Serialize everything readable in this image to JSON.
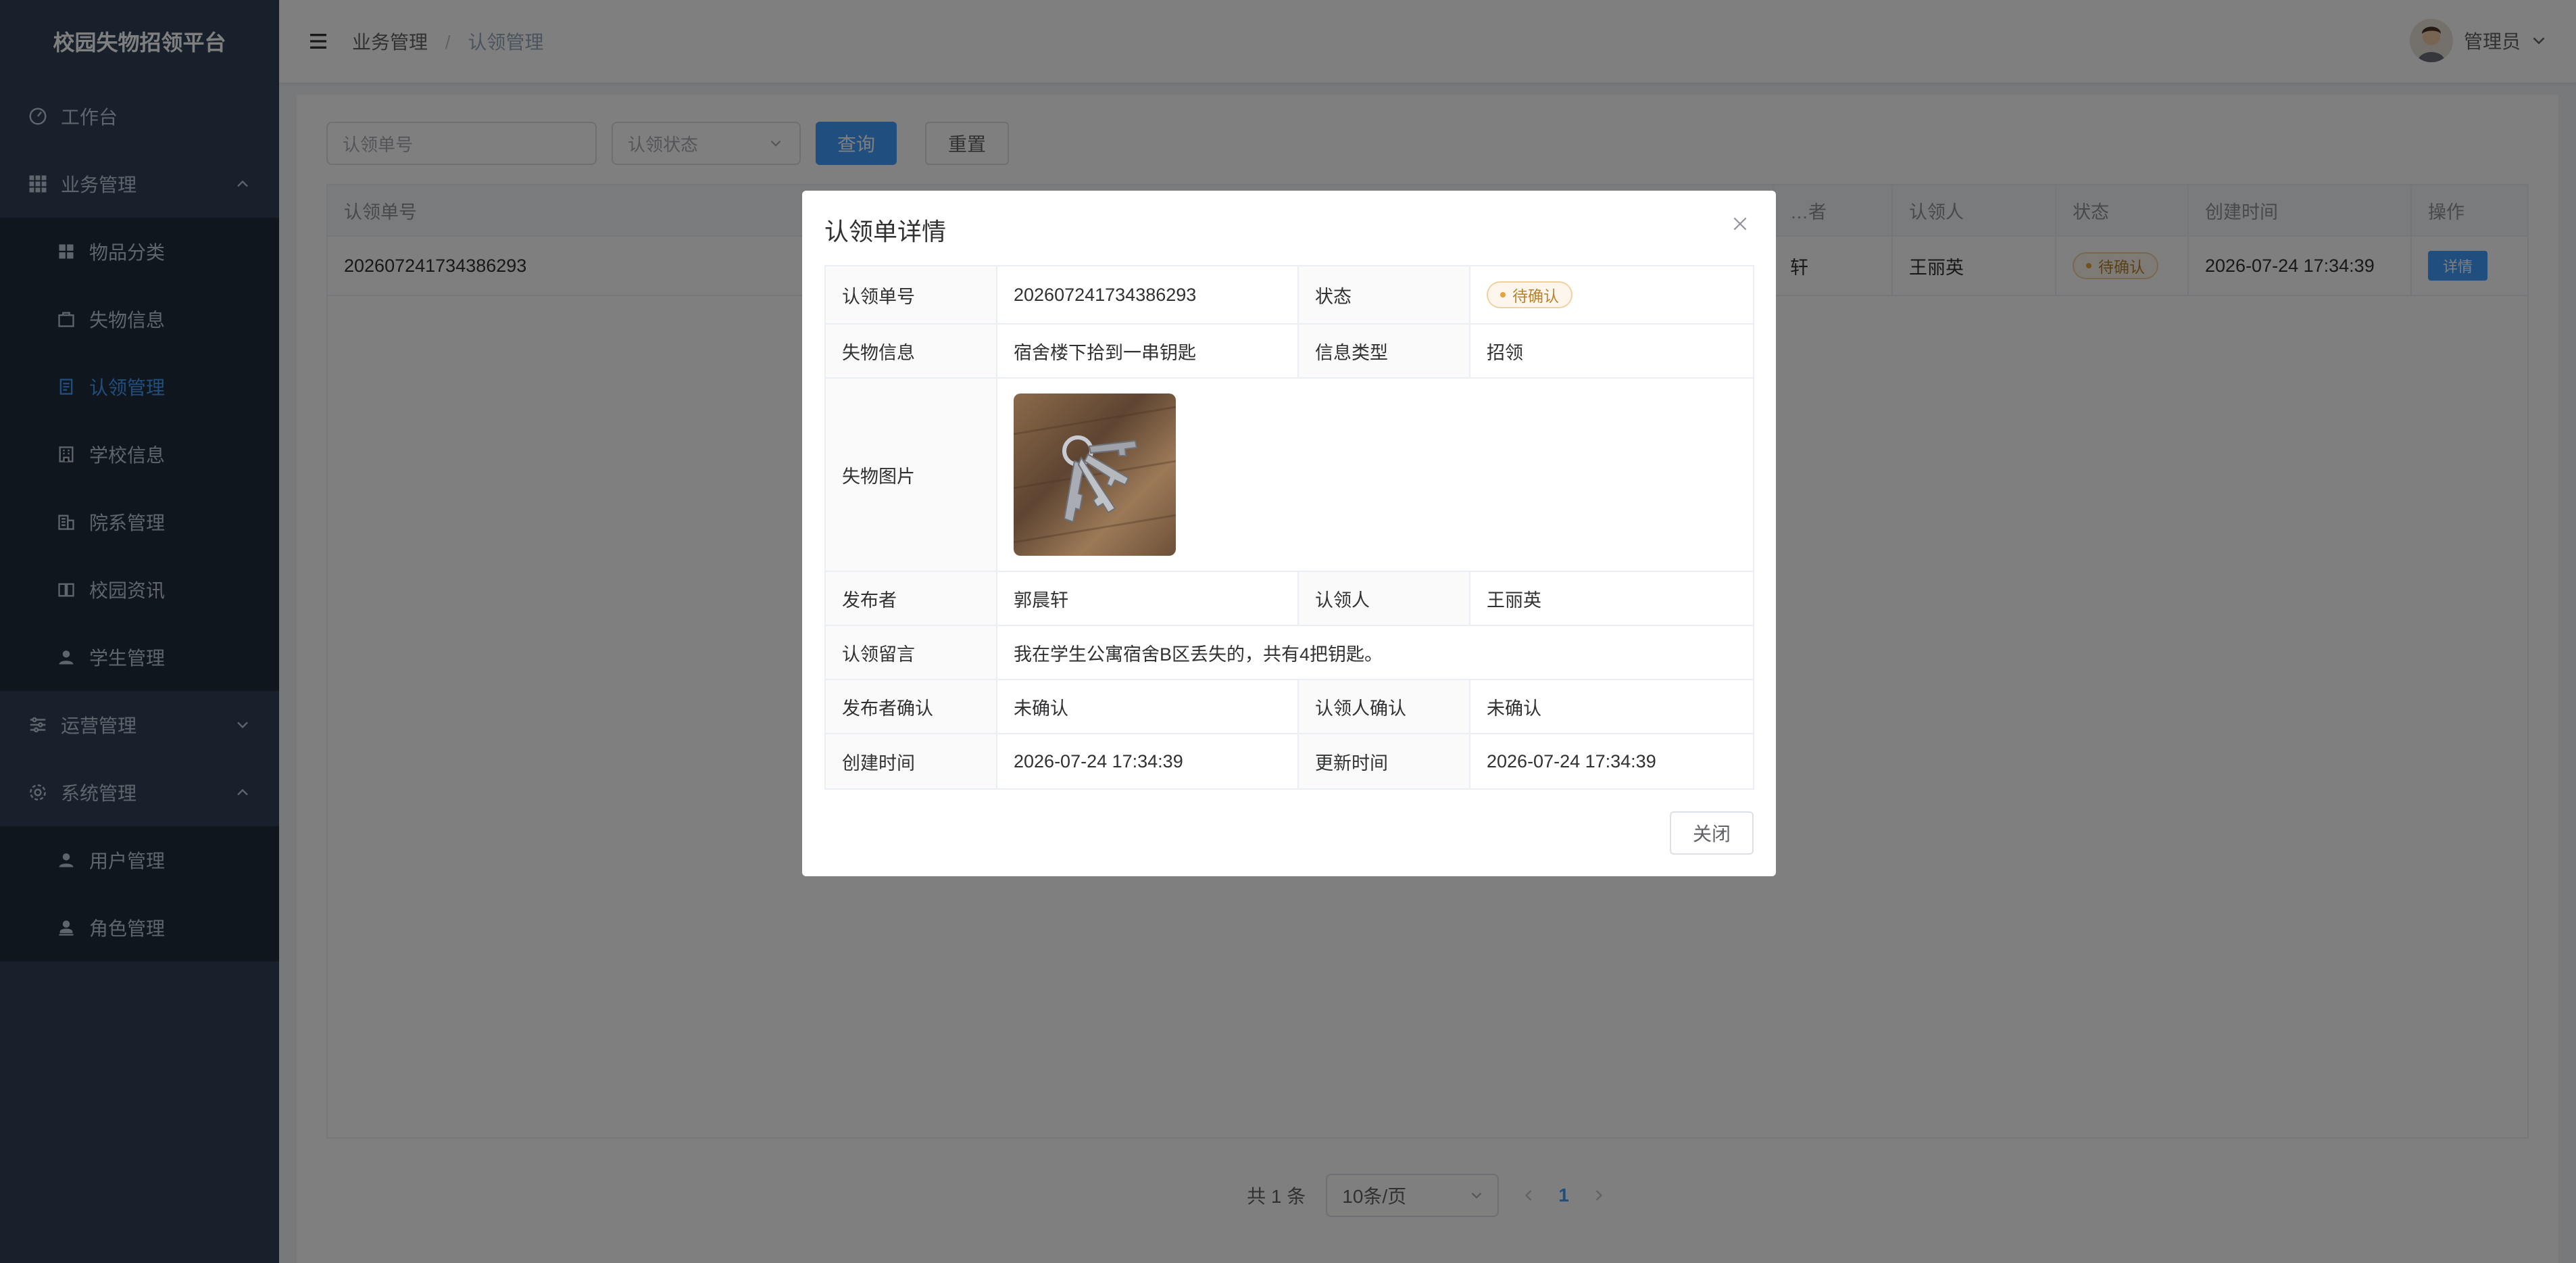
{
  "app": {
    "title": "校园失物招领平台"
  },
  "sidebar": {
    "items": [
      {
        "label": "工作台",
        "icon": "dashboard-icon"
      },
      {
        "label": "业务管理",
        "icon": "grid-icon",
        "expanded": true,
        "children": [
          {
            "label": "物品分类",
            "icon": "category-icon"
          },
          {
            "label": "失物信息",
            "icon": "package-icon"
          },
          {
            "label": "认领管理",
            "icon": "document-icon",
            "active": true
          },
          {
            "label": "学校信息",
            "icon": "building-icon"
          },
          {
            "label": "院系管理",
            "icon": "office-icon"
          },
          {
            "label": "校园资讯",
            "icon": "book-icon"
          },
          {
            "label": "学生管理",
            "icon": "person-icon"
          }
        ]
      },
      {
        "label": "运营管理",
        "icon": "sliders-icon",
        "expanded": false
      },
      {
        "label": "系统管理",
        "icon": "gear-icon",
        "expanded": true,
        "children": [
          {
            "label": "用户管理",
            "icon": "person-icon"
          },
          {
            "label": "角色管理",
            "icon": "role-icon"
          }
        ]
      }
    ]
  },
  "header": {
    "breadcrumb": [
      "业务管理",
      "认领管理"
    ],
    "breadcrumb_sep": "/",
    "user": "管理员"
  },
  "filter": {
    "claim_no_placeholder": "认领单号",
    "status_placeholder": "认领状态",
    "query_label": "查询",
    "reset_label": "重置"
  },
  "table": {
    "headers": [
      "认领单号",
      "…者",
      "认领人",
      "状态",
      "创建时间",
      "操作"
    ],
    "rows": [
      {
        "claim_no": "202607241734386293",
        "publisher_tail": "轩",
        "claimant": "王丽英",
        "status": "待确认",
        "created": "2026-07-24 17:34:39",
        "action": "详情"
      }
    ]
  },
  "pager": {
    "total": "共 1 条",
    "page_size": "10条/页",
    "current": "1"
  },
  "dialog": {
    "title": "认领单详情",
    "labels": {
      "claim_no": "认领单号",
      "status": "状态",
      "lost_info": "失物信息",
      "info_type": "信息类型",
      "lost_image": "失物图片",
      "publisher": "发布者",
      "claimant": "认领人",
      "message": "认领留言",
      "publisher_confirm": "发布者确认",
      "claimant_confirm": "认领人确认",
      "created": "创建时间",
      "updated": "更新时间"
    },
    "values": {
      "claim_no": "202607241734386293",
      "status": "待确认",
      "lost_info": "宿舍楼下拾到一串钥匙",
      "info_type": "招领",
      "publisher": "郭晨轩",
      "claimant": "王丽英",
      "message": "我在学生公寓宿舍B区丢失的，共有4把钥匙。",
      "publisher_confirm": "未确认",
      "claimant_confirm": "未确认",
      "created": "2026-07-24 17:34:39",
      "updated": "2026-07-24 17:34:39"
    },
    "close_label": "关闭"
  },
  "colors": {
    "sidebar_bg": "#304156",
    "accent": "#409eff",
    "warning": "#e6a23c"
  }
}
